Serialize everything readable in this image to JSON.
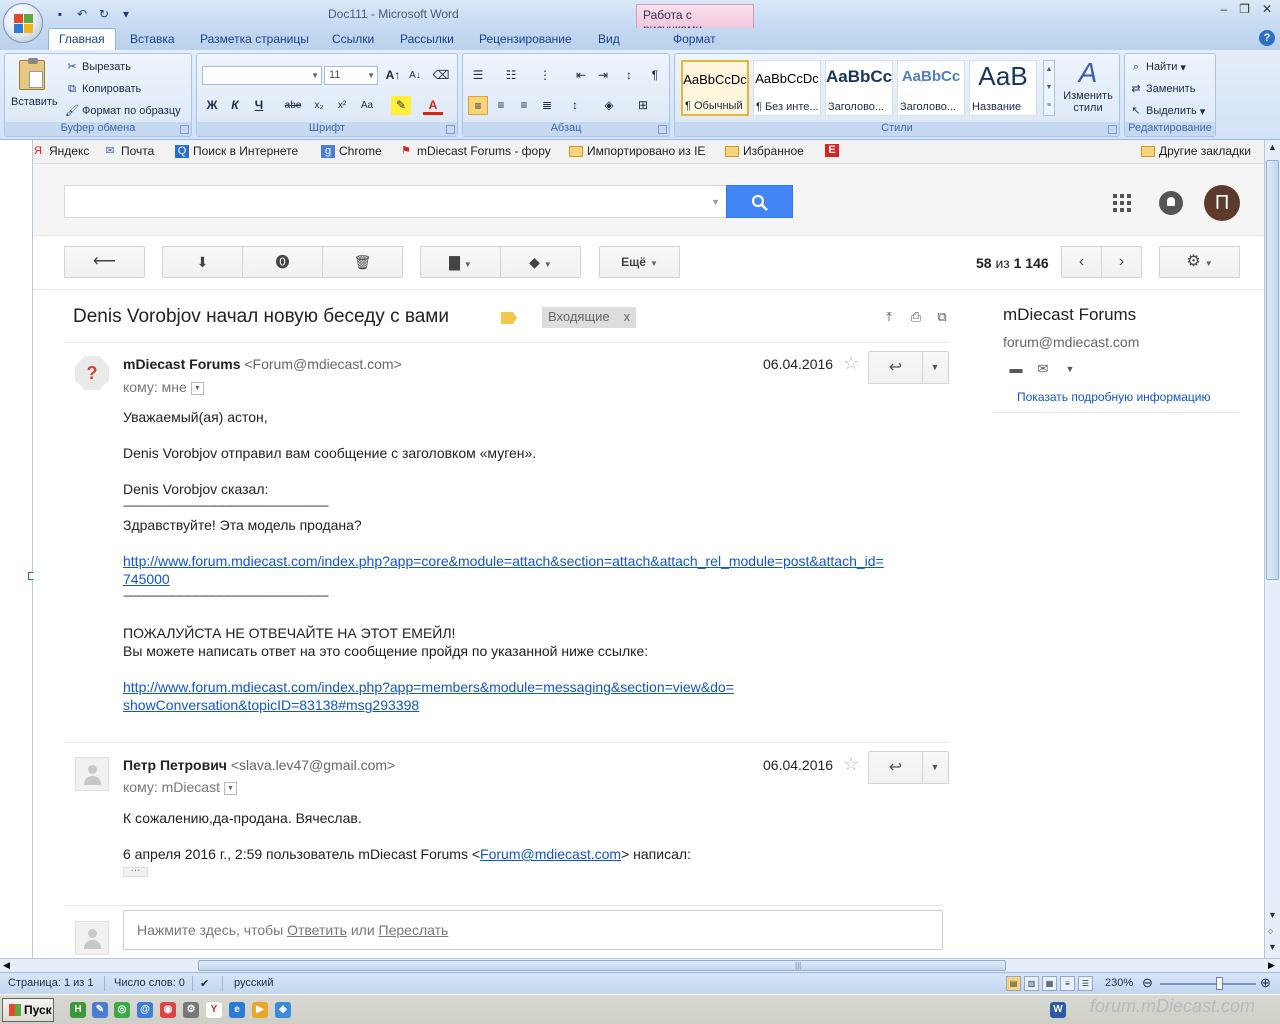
{
  "word": {
    "doc_title": "Doc111 - Microsoft Word",
    "context_tab_header": "Работа с рисунками",
    "tabs": [
      "Главная",
      "Вставка",
      "Разметка страницы",
      "Ссылки",
      "Рассылки",
      "Рецензирование",
      "Вид",
      "Формат"
    ],
    "clipboard": {
      "paste": "Вставить",
      "cut": "Вырезать",
      "copy": "Копировать",
      "format_painter": "Формат по образцу",
      "label": "Буфер обмена"
    },
    "font": {
      "size": "11",
      "label": "Шрифт"
    },
    "paragraph": {
      "label": "Абзац"
    },
    "styles": {
      "label": "Стили",
      "items": [
        {
          "sample": "AaBbCcDc",
          "name": "¶ Обычный"
        },
        {
          "sample": "AaBbCcDc",
          "name": "¶ Без инте..."
        },
        {
          "sample": "AaBbCc",
          "name": "Заголово..."
        },
        {
          "sample": "AaBbCc",
          "name": "Заголово..."
        },
        {
          "sample": "АаВ",
          "name": "Название"
        }
      ],
      "change": "Изменить стили"
    },
    "editing": {
      "label": "Редактирование",
      "find": "Найти",
      "replace": "Заменить",
      "select": "Выделить"
    },
    "status": {
      "page": "Страница: 1 из 1",
      "words": "Число слов: 0",
      "language": "русский",
      "zoom": "230%"
    },
    "taskbar": {
      "start": "Пуск",
      "watermark": "forum.mDiecast.com"
    }
  },
  "bookmarks": [
    {
      "label": "Яндекс",
      "icon": "yandex-icon"
    },
    {
      "label": "Почта",
      "icon": "mail-icon"
    },
    {
      "label": "Поиск в Интернете",
      "icon": "search-icon"
    },
    {
      "label": "Chrome",
      "icon": "chrome-icon"
    },
    {
      "label": "mDiecast Forums - фору",
      "icon": "mdiecast-icon"
    },
    {
      "label": "Импортировано из IE",
      "icon": "folder-icon"
    },
    {
      "label": "Избранное",
      "icon": "folder-icon"
    },
    {
      "label": "Другие закладки",
      "icon": "folder-icon"
    }
  ],
  "gmail": {
    "avatar_letter": "П",
    "toolbar": {
      "more": "Ещё"
    },
    "pager": {
      "range": "58",
      "of": "из",
      "total": "1 146"
    },
    "subject": "Denis Vorobjov начал новую беседу с вами",
    "label_chip": "Входящие",
    "label_chip_close": "x",
    "messages": [
      {
        "sender_name": "mDiecast Forums",
        "sender_email": "<Forum@mdiecast.com>",
        "to": "кому: мне",
        "date": "06.04.2016",
        "body": {
          "greeting": "Уважаемый(ая) астон,",
          "line1": "Denis Vorobjov отправил вам сообщение с заголовком «муген».",
          "line2": "Denis Vorobjov сказал:",
          "dashes": "-----------------------------------------------------------------------------",
          "quote": "Здравствуйте! Эта модель продана?",
          "link1a": "http://www.forum.mdiecast.com/index.php?app=core&module=attach&section=attach&attach_rel_module=post&attach_id=",
          "link1b": "745000",
          "warning": "ПОЖАЛУЙСТА НЕ ОТВЕЧАЙТЕ НА ЭТОТ ЕМЕЙЛ!",
          "instructions": "Вы можете написать ответ на это сообщение пройдя по указанной ниже ссылке:",
          "link2a": "http://www.forum.mdiecast.com/index.php?app=members&module=messaging&section=view&do=",
          "link2b": "showConversation&topicID=83138#msg293398"
        }
      },
      {
        "sender_name": "Петр Петрович",
        "sender_email": "<slava.lev47@gmail.com>",
        "to": "кому: mDiecast",
        "date": "06.04.2016",
        "body": {
          "line1": "К сожалению,да-продана. Вячеслав.",
          "quote_prefix": "6 апреля 2016 г., 2:59 пользователь mDiecast Forums <",
          "quote_link": "Forum@mdiecast.com",
          "quote_suffix": "> написал:",
          "ellipsis": "···"
        }
      }
    ],
    "reply_box": {
      "prefix": "Нажмите здесь, чтобы ",
      "reply": "Ответить",
      "or": " или ",
      "forward": "Переслать"
    },
    "side_panel": {
      "name": "mDiecast Forums",
      "email": "forum@mdiecast.com",
      "more_info": "Показать подробную информацию"
    }
  }
}
